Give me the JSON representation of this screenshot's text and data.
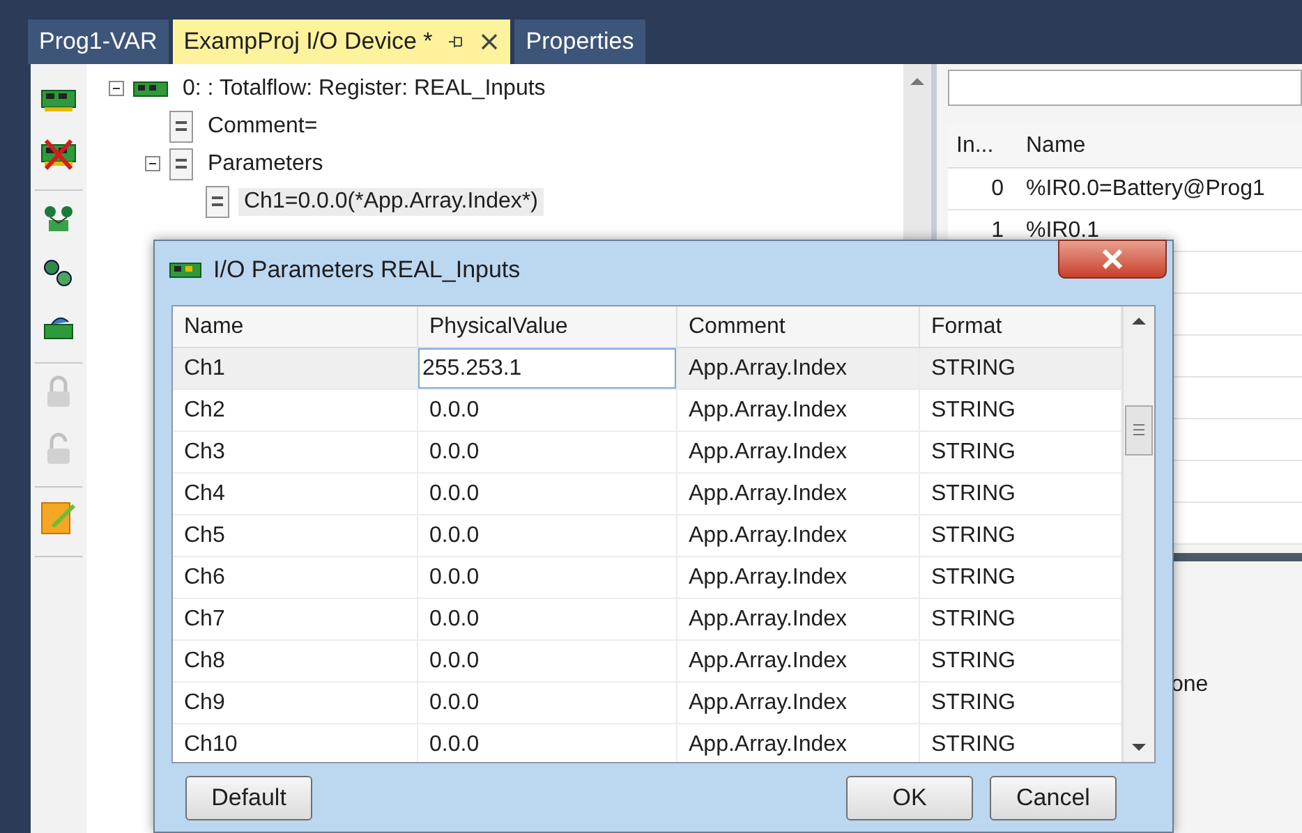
{
  "tabs": [
    {
      "label": "Prog1-VAR",
      "selected": false
    },
    {
      "label": "ExampProj I/O Device *",
      "selected": true
    },
    {
      "label": "Properties",
      "selected": false
    }
  ],
  "toolbar_groups": [
    {
      "items": [
        {
          "kind": "board",
          "disabled": false
        },
        {
          "kind": "board-remove",
          "disabled": false
        }
      ]
    },
    {
      "items": [
        {
          "kind": "network",
          "disabled": false
        },
        {
          "kind": "gears",
          "disabled": false
        },
        {
          "kind": "card",
          "disabled": false
        }
      ]
    },
    {
      "items": [
        {
          "kind": "lock",
          "disabled": true
        },
        {
          "kind": "unlock",
          "disabled": true
        }
      ]
    },
    {
      "items": [
        {
          "kind": "note",
          "disabled": false
        }
      ]
    }
  ],
  "tree": [
    {
      "label": "0: : Totalflow: Register: REAL_Inputs",
      "kind": "device",
      "expanded": true,
      "selected": false,
      "children": [
        {
          "label": "Comment=",
          "kind": "param",
          "selected": false
        },
        {
          "label": "Parameters",
          "kind": "param",
          "expanded": true,
          "selected": false,
          "children": [
            {
              "label": "Ch1=0.0.0(*App.Array.Index*)",
              "kind": "param",
              "selected": true
            }
          ]
        }
      ]
    }
  ],
  "right_panel": {
    "columns": [
      "In...",
      "Name"
    ],
    "rows": [
      {
        "index": "0",
        "name": "%IR0.0=Battery@Prog1"
      },
      {
        "index": "1",
        "name": "%IR0.1"
      }
    ],
    "lower_text": "one"
  },
  "dialog": {
    "title": "I/O Parameters REAL_Inputs",
    "columns": [
      "Name",
      "PhysicalValue",
      "Comment",
      "Format"
    ],
    "rows": [
      {
        "name": "Ch1",
        "value": "255.253.1",
        "comment": "App.Array.Index",
        "format": "STRING",
        "selected": true,
        "editing": true
      },
      {
        "name": "Ch2",
        "value": "0.0.0",
        "comment": "App.Array.Index",
        "format": "STRING",
        "selected": false,
        "editing": false
      },
      {
        "name": "Ch3",
        "value": "0.0.0",
        "comment": "App.Array.Index",
        "format": "STRING",
        "selected": false,
        "editing": false
      },
      {
        "name": "Ch4",
        "value": "0.0.0",
        "comment": "App.Array.Index",
        "format": "STRING",
        "selected": false,
        "editing": false
      },
      {
        "name": "Ch5",
        "value": "0.0.0",
        "comment": "App.Array.Index",
        "format": "STRING",
        "selected": false,
        "editing": false
      },
      {
        "name": "Ch6",
        "value": "0.0.0",
        "comment": "App.Array.Index",
        "format": "STRING",
        "selected": false,
        "editing": false
      },
      {
        "name": "Ch7",
        "value": "0.0.0",
        "comment": "App.Array.Index",
        "format": "STRING",
        "selected": false,
        "editing": false
      },
      {
        "name": "Ch8",
        "value": "0.0.0",
        "comment": "App.Array.Index",
        "format": "STRING",
        "selected": false,
        "editing": false
      },
      {
        "name": "Ch9",
        "value": "0.0.0",
        "comment": "App.Array.Index",
        "format": "STRING",
        "selected": false,
        "editing": false
      },
      {
        "name": "Ch10",
        "value": "0.0.0",
        "comment": "App.Array.Index",
        "format": "STRING",
        "selected": false,
        "editing": false
      }
    ],
    "left_buttons": [
      "Default"
    ],
    "right_buttons": [
      "OK",
      "Cancel"
    ]
  }
}
